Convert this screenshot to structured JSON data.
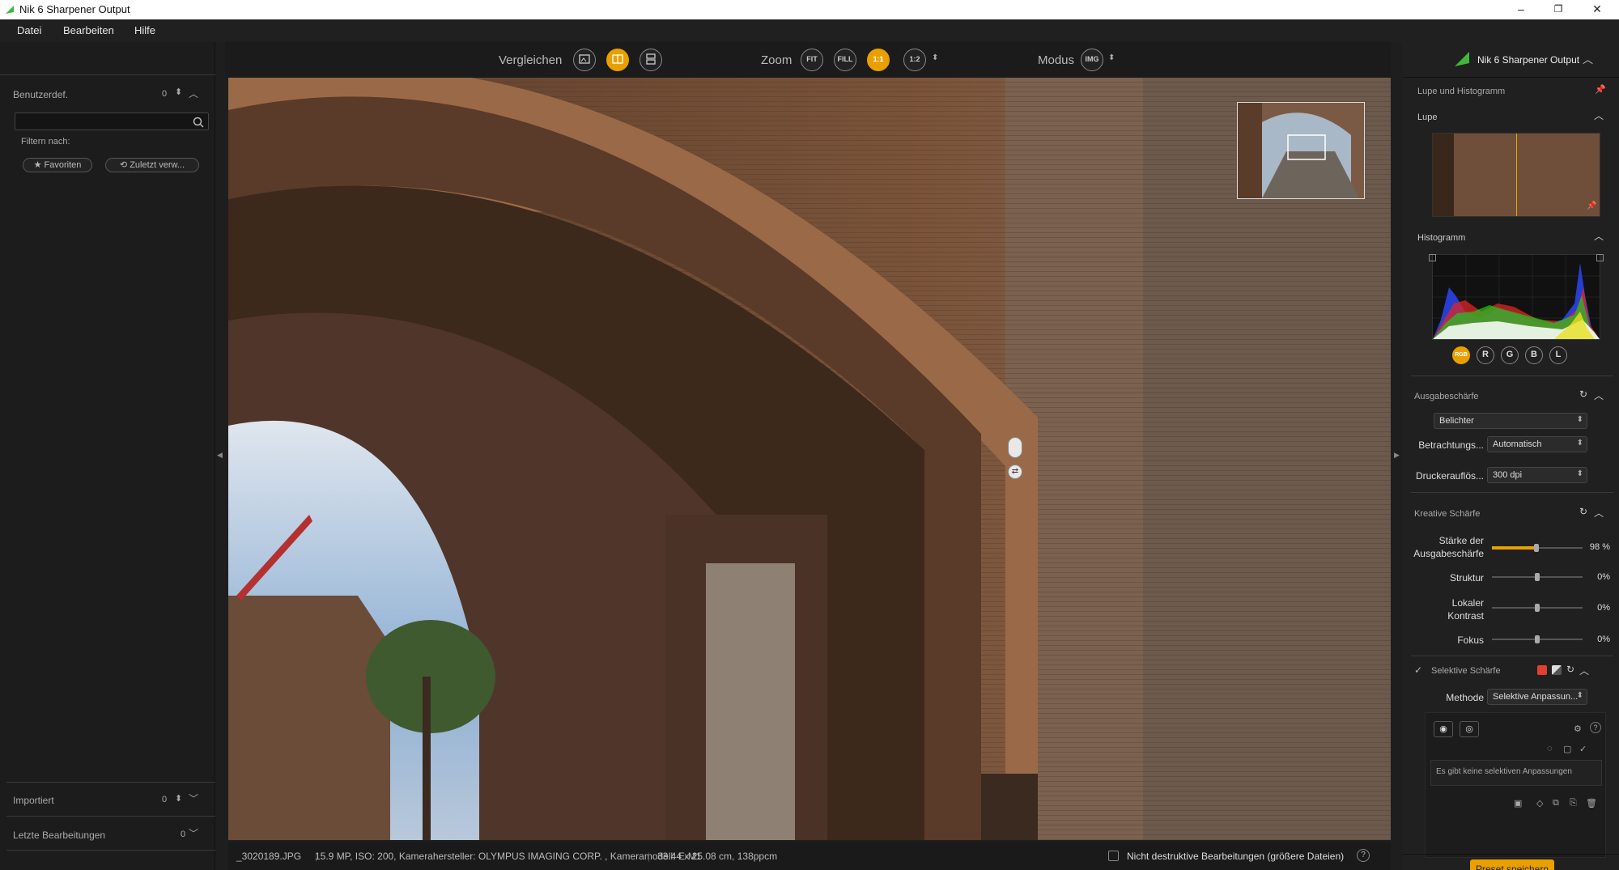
{
  "window": {
    "title": "Nik 6 Sharpener Output",
    "minimize": "–",
    "maximize": "❐",
    "close": "✕"
  },
  "menu": [
    "Datei",
    "Bearbeiten",
    "Hilfe"
  ],
  "left": {
    "custom_label": "Benutzerdef.",
    "custom_count": "0",
    "search_placeholder": "",
    "filter_label": "Filtern nach:",
    "favorites": "★ Favoriten",
    "recent": "⟲ Zuletzt verw...",
    "imported_label": "Importiert",
    "imported_count": "0",
    "recent_edits_label": "Letzte Bearbeitungen",
    "recent_edits_count": "0"
  },
  "toolbar": {
    "compare_label": "Vergleichen",
    "zoom_label": "Zoom",
    "zoom_fit": "FIT",
    "zoom_fill": "FILL",
    "zoom_1_1": "1:1",
    "zoom_1_2": "1:2",
    "mode_label": "Modus",
    "mode_value": "IMG"
  },
  "status": {
    "filename": "_3020189.JPG",
    "info": "15.9 MP, ISO: 200, Kamerahersteller: OLYMPUS IMAGING CORP.  , Kameramodell: E-M1",
    "size": "33.44 x 25.08 cm, 138ppcm",
    "nondestructive": "Nicht destruktive Bearbeitungen (größere Dateien)",
    "help": "?"
  },
  "right": {
    "product": "Nik 6 Sharpener Output",
    "loupe_hist_header": "Lupe und Histogramm",
    "loupe_header": "Lupe",
    "histogram_header": "Histogramm",
    "channels": [
      "RGB",
      "R",
      "G",
      "B",
      "L"
    ],
    "output_sharpening_header": "Ausgabeschärfe",
    "output_type": "Belichter",
    "viewing_label": "Betrachtungs...",
    "viewing_value": "Automatisch",
    "printer_res_label": "Druckerauflös...",
    "printer_res_value": "300 dpi",
    "creative_header": "Kreative Schärfe",
    "sliders": [
      {
        "label": "Stärke der Ausgabeschärfe",
        "value": "98 %",
        "level": 0.49
      },
      {
        "label": "Struktur",
        "value": "0%",
        "level": 0.5
      },
      {
        "label": "Lokaler Kontrast",
        "value": "0%",
        "level": 0.5
      },
      {
        "label": "Fokus",
        "value": "0%",
        "level": 0.5
      }
    ],
    "selective_header": "Selektive Schärfe",
    "method_label": "Methode",
    "method_value": "Selektive Anpassun...",
    "no_selective": "Es gibt keine selektiven Anpassungen",
    "save_preset": "Preset speichern"
  },
  "colors": {
    "accent": "#e8a000"
  }
}
